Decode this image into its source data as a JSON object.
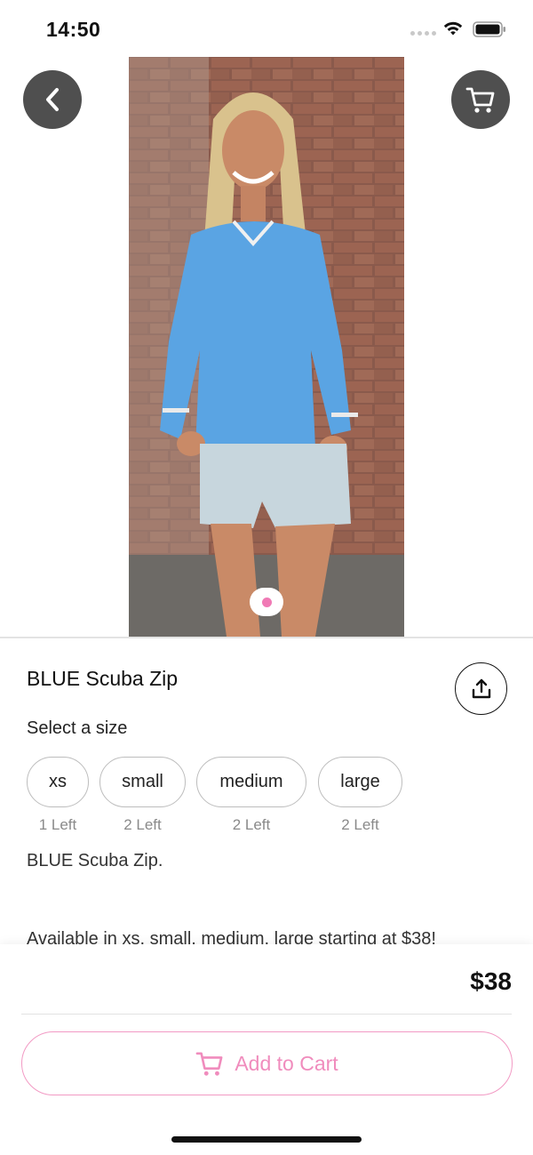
{
  "status_bar": {
    "time": "14:50"
  },
  "product": {
    "title": "BLUE Scuba Zip",
    "description": "BLUE Scuba Zip.",
    "availability": "Available in xs, small, medium, large starting at $38!",
    "price": "$38"
  },
  "size_section": {
    "heading": "Select a size",
    "sizes": [
      {
        "label": "xs",
        "stock": "1 Left"
      },
      {
        "label": "small",
        "stock": "2 Left"
      },
      {
        "label": "medium",
        "stock": "2 Left"
      },
      {
        "label": "large",
        "stock": "2 Left"
      }
    ]
  },
  "actions": {
    "add_to_cart": "Add to Cart"
  },
  "icons": {
    "back": "chevron-left-icon",
    "cart": "cart-icon",
    "share": "share-icon",
    "add_cart": "cart-icon"
  },
  "colors": {
    "accent_pink": "#f07ab5",
    "button_dark": "#4f4f4f",
    "chip_border": "#bdbdbd"
  }
}
